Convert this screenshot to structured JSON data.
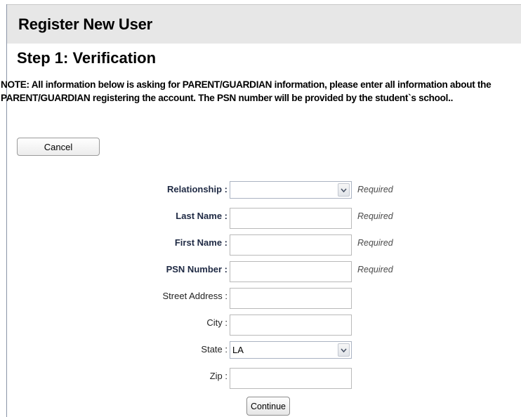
{
  "header": {
    "title": "Register New User"
  },
  "step": {
    "title": "Step 1: Verification"
  },
  "note": "NOTE: All information below is asking for PARENT/GUARDIAN information, please enter all information about the PARENT/GUARDIAN registering the account. The PSN number will be provided by the student`s school..",
  "buttons": {
    "cancel": "Cancel",
    "continue": "Continue"
  },
  "form": {
    "relationship": {
      "label": "Relationship :",
      "value": "",
      "required": "Required",
      "control": "dropdown"
    },
    "last_name": {
      "label": "Last Name :",
      "value": "",
      "required": "Required"
    },
    "first_name": {
      "label": "First Name :",
      "value": "",
      "required": "Required"
    },
    "psn_number": {
      "label": "PSN Number :",
      "value": "",
      "required": "Required"
    },
    "street_address": {
      "label": "Street Address :",
      "value": ""
    },
    "city": {
      "label": "City :",
      "value": ""
    },
    "state": {
      "label": "State :",
      "value": "LA",
      "control": "dropdown"
    },
    "zip": {
      "label": "Zip :",
      "value": ""
    }
  },
  "icons": {
    "dropdown": "chevron-down-icon"
  },
  "colors": {
    "header_bg": "#e7e7e7",
    "required_label": "#1f2a44",
    "required_text": "#4b4b4b"
  }
}
